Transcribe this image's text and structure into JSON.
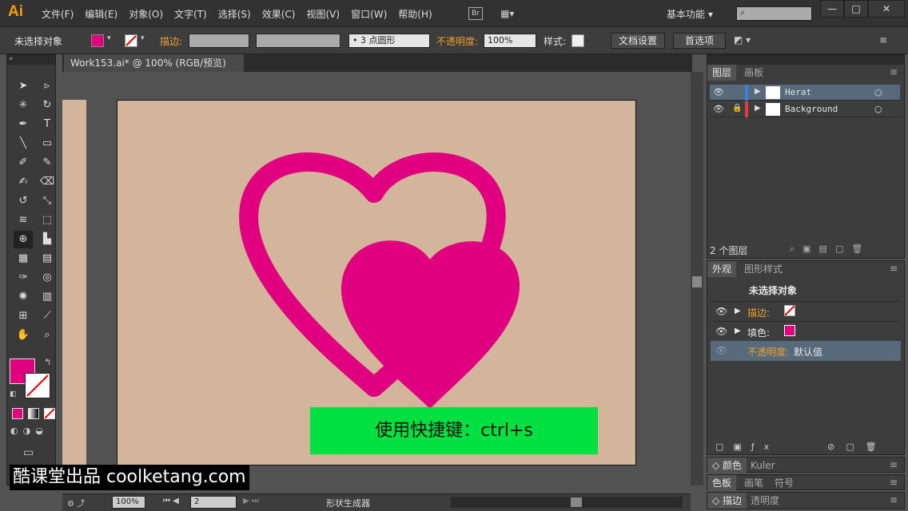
{
  "app": {
    "logo": "Ai"
  },
  "menubar": {
    "items": [
      "文件(F)",
      "编辑(E)",
      "对象(O)",
      "文字(T)",
      "选择(S)",
      "效果(C)",
      "视图(V)",
      "窗口(W)",
      "帮助(H)"
    ],
    "bridge": "Br",
    "workspace": "基本功能",
    "window_controls": [
      "—",
      "□",
      "✕"
    ]
  },
  "control_bar": {
    "selection": "未选择对象",
    "stroke_label": "描边:",
    "brush": "• 3 点圆形",
    "opacity_label": "不透明度:",
    "opacity_value": "100%",
    "style_label": "样式:",
    "doc_setup": "文档设置",
    "preferences": "首选项"
  },
  "document": {
    "tab_title": "Work153.ai* @ 100% (RGB/预览)",
    "close": "×"
  },
  "colors": {
    "fill": "#e0007f",
    "artboard": "#d3b59b",
    "banner": "#00e040"
  },
  "canvas": {
    "banner_text": "使用快捷键：ctrl+s"
  },
  "layers_panel": {
    "tabs": [
      "图层",
      "画板"
    ],
    "layers": [
      {
        "name": "Herat",
        "color": "#3c7de0"
      },
      {
        "name": "Background",
        "color": "#e03c3c"
      }
    ],
    "count": "2 个图层"
  },
  "appearance_panel": {
    "tabs": [
      "外观",
      "图形样式"
    ],
    "title": "未选择对象",
    "rows": [
      {
        "label": "描边:"
      },
      {
        "label": "填色:"
      },
      {
        "label": "不透明度:",
        "value": "默认值"
      }
    ]
  },
  "collapsed_panels": [
    {
      "tabs": [
        "颜色",
        "Kuler"
      ]
    },
    {
      "tabs": [
        "色板",
        "画笔",
        "符号"
      ]
    },
    {
      "tabs": [
        "描边",
        "透明度"
      ]
    }
  ],
  "status_bar": {
    "zoom": "100%",
    "page": "2",
    "tool": "形状生成器"
  },
  "watermark": "酷课堂出品 coolketang.com"
}
